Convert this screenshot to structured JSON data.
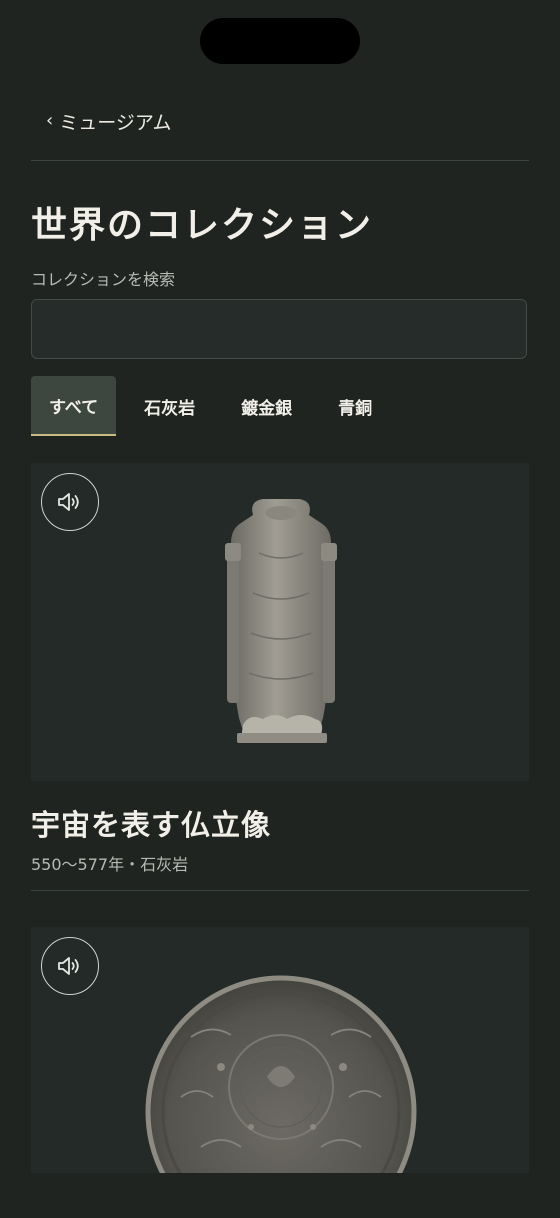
{
  "header": {
    "back_label": "ミュージアム"
  },
  "page": {
    "title": "世界のコレクション"
  },
  "search": {
    "label": "コレクションを検索",
    "value": ""
  },
  "filters": [
    {
      "label": "すべて",
      "active": true
    },
    {
      "label": "石灰岩",
      "active": false
    },
    {
      "label": "鍍金銀",
      "active": false
    },
    {
      "label": "青銅",
      "active": false
    }
  ],
  "collection": [
    {
      "title": "宇宙を表す仏立像",
      "meta": "550〜577年・石灰岩",
      "image": "standing-buddha-statue",
      "audio_icon": "speaker-icon"
    },
    {
      "title": "",
      "meta": "",
      "image": "gilded-silver-dish",
      "audio_icon": "speaker-icon"
    }
  ],
  "colors": {
    "background": "#1f2421",
    "card": "#232a27",
    "accent": "#cdbb86",
    "active_tab": "#3d473f"
  }
}
